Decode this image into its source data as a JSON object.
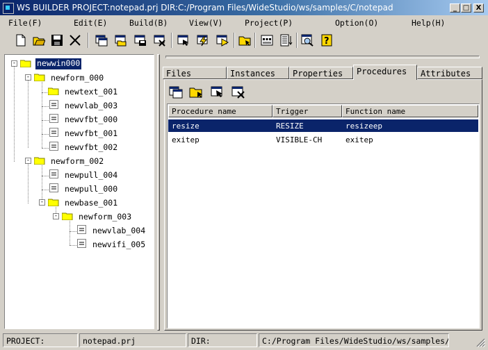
{
  "window": {
    "title": "WS BUILDER PROJECT:notepad.prj DIR:C:/Program Files/WideStudio/ws/samples/C/notepad",
    "minimize": "_",
    "maximize": "□",
    "close": "X"
  },
  "menu": [
    "File(F)",
    "Edit(E)",
    "Build(B)",
    "View(V)",
    "Project(P)",
    "Option(O)",
    "Help(H)"
  ],
  "tree": {
    "nodes": [
      {
        "label": "newwin000",
        "type": "folder",
        "selected": true
      },
      {
        "label": "newform_000",
        "type": "folder"
      },
      {
        "label": "newtext_001",
        "type": "folder"
      },
      {
        "label": "newvlab_003",
        "type": "file"
      },
      {
        "label": "newvfbt_000",
        "type": "file"
      },
      {
        "label": "newvfbt_001",
        "type": "file"
      },
      {
        "label": "newvfbt_002",
        "type": "file"
      },
      {
        "label": "newform_002",
        "type": "folder"
      },
      {
        "label": "newpull_004",
        "type": "file"
      },
      {
        "label": "newpull_000",
        "type": "file"
      },
      {
        "label": "newbase_001",
        "type": "folder"
      },
      {
        "label": "newform_003",
        "type": "folder"
      },
      {
        "label": "newvlab_004",
        "type": "file"
      },
      {
        "label": "newvifi_005",
        "type": "file"
      }
    ]
  },
  "tabs": [
    "Files",
    "Instances",
    "Properties",
    "Procedures",
    "Attributes"
  ],
  "active_tab": "Procedures",
  "procedures": {
    "columns": [
      "Procedure name",
      "Trigger",
      "Function name"
    ],
    "rows": [
      {
        "name": "resize",
        "trigger": "RESIZE",
        "function": "resizeep",
        "selected": true
      },
      {
        "name": "exitep",
        "trigger": "VISIBLE-CH",
        "function": "exitep"
      }
    ]
  },
  "status": {
    "project_label": "PROJECT:",
    "project_value": "notepad.prj",
    "dir_label": "DIR:",
    "dir_value": "C:/Program Files/WideStudio/ws/samples/C/notepad"
  },
  "colors": {
    "selection": "#0a246a",
    "face": "#d4d0c8",
    "folder": "#ffff00"
  },
  "toolbar_icons": [
    "new-file-icon",
    "open-folder-icon",
    "save-disk-icon",
    "cut-icon",
    "new-window-icon",
    "open-window-icon",
    "save-window-icon",
    "delete-window-icon",
    "select-icon",
    "build-icon",
    "run-icon",
    "open-project-icon",
    "dialog-icon",
    "list-icon",
    "preview-icon",
    "help-icon"
  ],
  "procedure_toolbar_icons": [
    "new-procedure-icon",
    "open-procedure-icon",
    "edit-procedure-icon",
    "delete-procedure-icon"
  ]
}
